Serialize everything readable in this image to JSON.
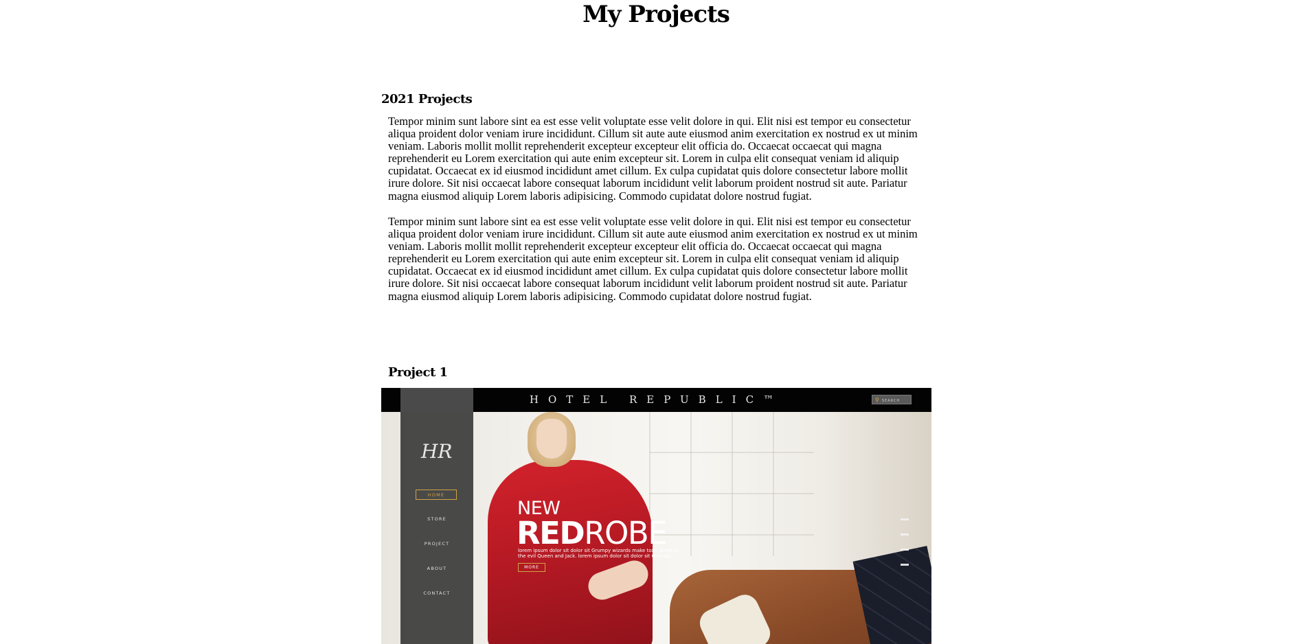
{
  "page": {
    "title": "My Projects",
    "section_heading": "2021 Projects",
    "paragraphs": [
      "Tempor minim sunt labore sint ea est esse velit voluptate esse velit dolore in qui. Elit nisi est tempor eu consectetur aliqua proident dolor veniam irure incididunt. Cillum sit aute aute eiusmod anim exercitation ex nostrud ex ut minim veniam. Laboris mollit mollit reprehenderit excepteur excepteur elit officia do. Occaecat occaecat qui magna reprehenderit eu Lorem exercitation qui aute enim excepteur sit. Lorem in culpa elit consequat veniam id aliquip cupidatat. Occaecat ex id eiusmod incididunt amet cillum. Ex culpa cupidatat quis dolore consectetur labore mollit irure dolore. Sit nisi occaecat labore consequat laborum incididunt velit laborum proident nostrud sit aute. Pariatur magna eiusmod aliquip Lorem laboris adipisicing. Commodo cupidatat dolore nostrud fugiat.",
      "Tempor minim sunt labore sint ea est esse velit voluptate esse velit dolore in qui. Elit nisi est tempor eu consectetur aliqua proident dolor veniam irure incididunt. Cillum sit aute aute eiusmod anim exercitation ex nostrud ex ut minim veniam. Laboris mollit mollit reprehenderit excepteur excepteur elit officia do. Occaecat occaecat qui magna reprehenderit eu Lorem exercitation qui aute enim excepteur sit. Lorem in culpa elit consequat veniam id aliquip cupidatat. Occaecat ex id eiusmod incididunt amet cillum. Ex culpa cupidatat quis dolore consectetur labore mollit irure dolore. Sit nisi occaecat labore consequat laborum incididunt velit laborum proident nostrud sit aute. Pariatur magna eiusmod aliquip Lorem laboris adipisicing. Commodo cupidatat dolore nostrud fugiat."
    ],
    "project_heading": "Project 1"
  },
  "project_screenshot": {
    "brand": "HOTEL REPUBLIC™",
    "search_placeholder": "SEARCH",
    "logo": "HR",
    "nav": [
      "HOME",
      "STORE",
      "PROJECT",
      "ABOUT",
      "CONTACT"
    ],
    "promo": {
      "line1": "NEW",
      "line2_bold": "RED",
      "line2_light": "ROBE",
      "text": "lorem ipsum dolor sit dolor sit Grumpy wizards make toxic brew for the evil Queen and Jack. lorem ipsum dolor sit dolor sit Grumpy",
      "button": "MORE"
    },
    "colors": {
      "accent": "#d0a548",
      "topbar": "#030303",
      "robe": "#c41e27"
    }
  }
}
